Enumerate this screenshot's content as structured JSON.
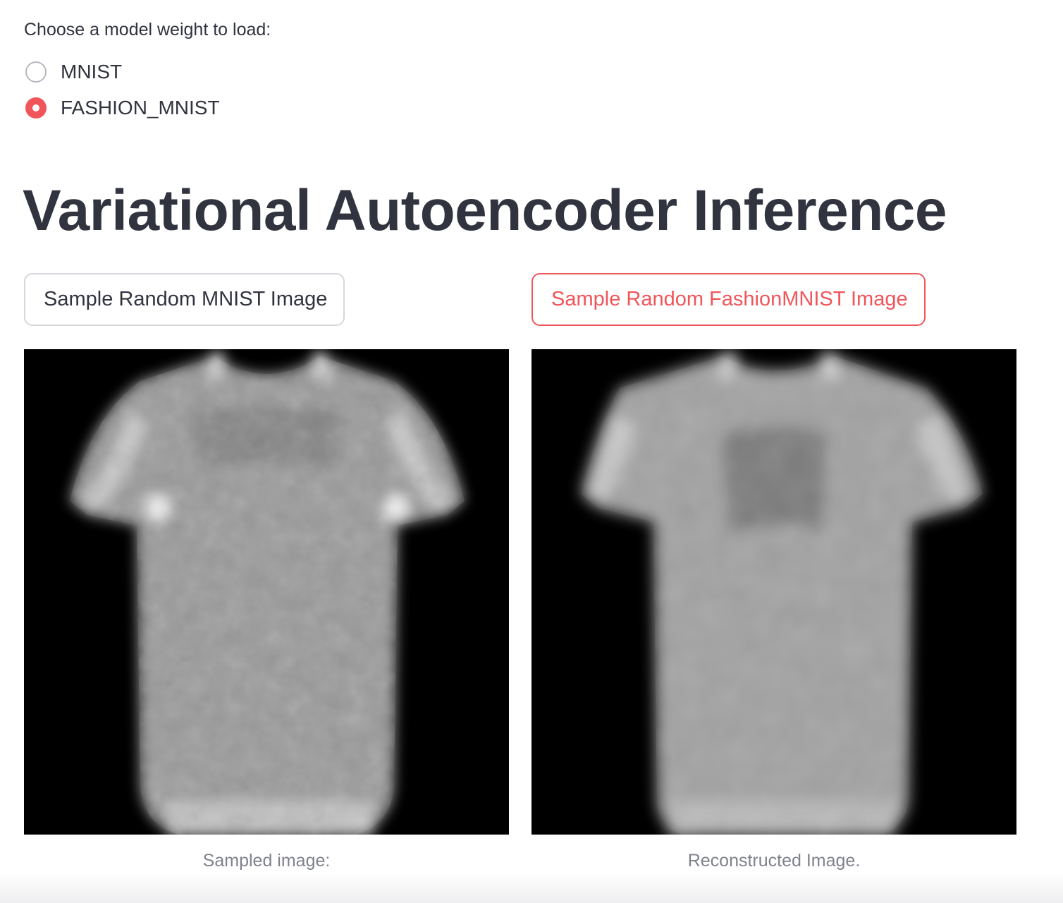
{
  "model_select": {
    "label": "Choose a model weight to load:",
    "options": [
      {
        "label": "MNIST",
        "selected": false
      },
      {
        "label": "FASHION_MNIST",
        "selected": true
      }
    ]
  },
  "title": "Variational Autoencoder Inference",
  "buttons": {
    "sample_mnist": "Sample Random MNIST Image",
    "sample_fashion": "Sample Random FashionMNIST Image"
  },
  "images": {
    "sampled": {
      "caption": "Sampled image:",
      "depicts": "t-shirt"
    },
    "reconstructed": {
      "caption": "Reconstructed Image.",
      "depicts": "t-shirt"
    }
  },
  "colors": {
    "accent": "#f0555a",
    "text": "#31333f",
    "caption": "#80828d"
  }
}
